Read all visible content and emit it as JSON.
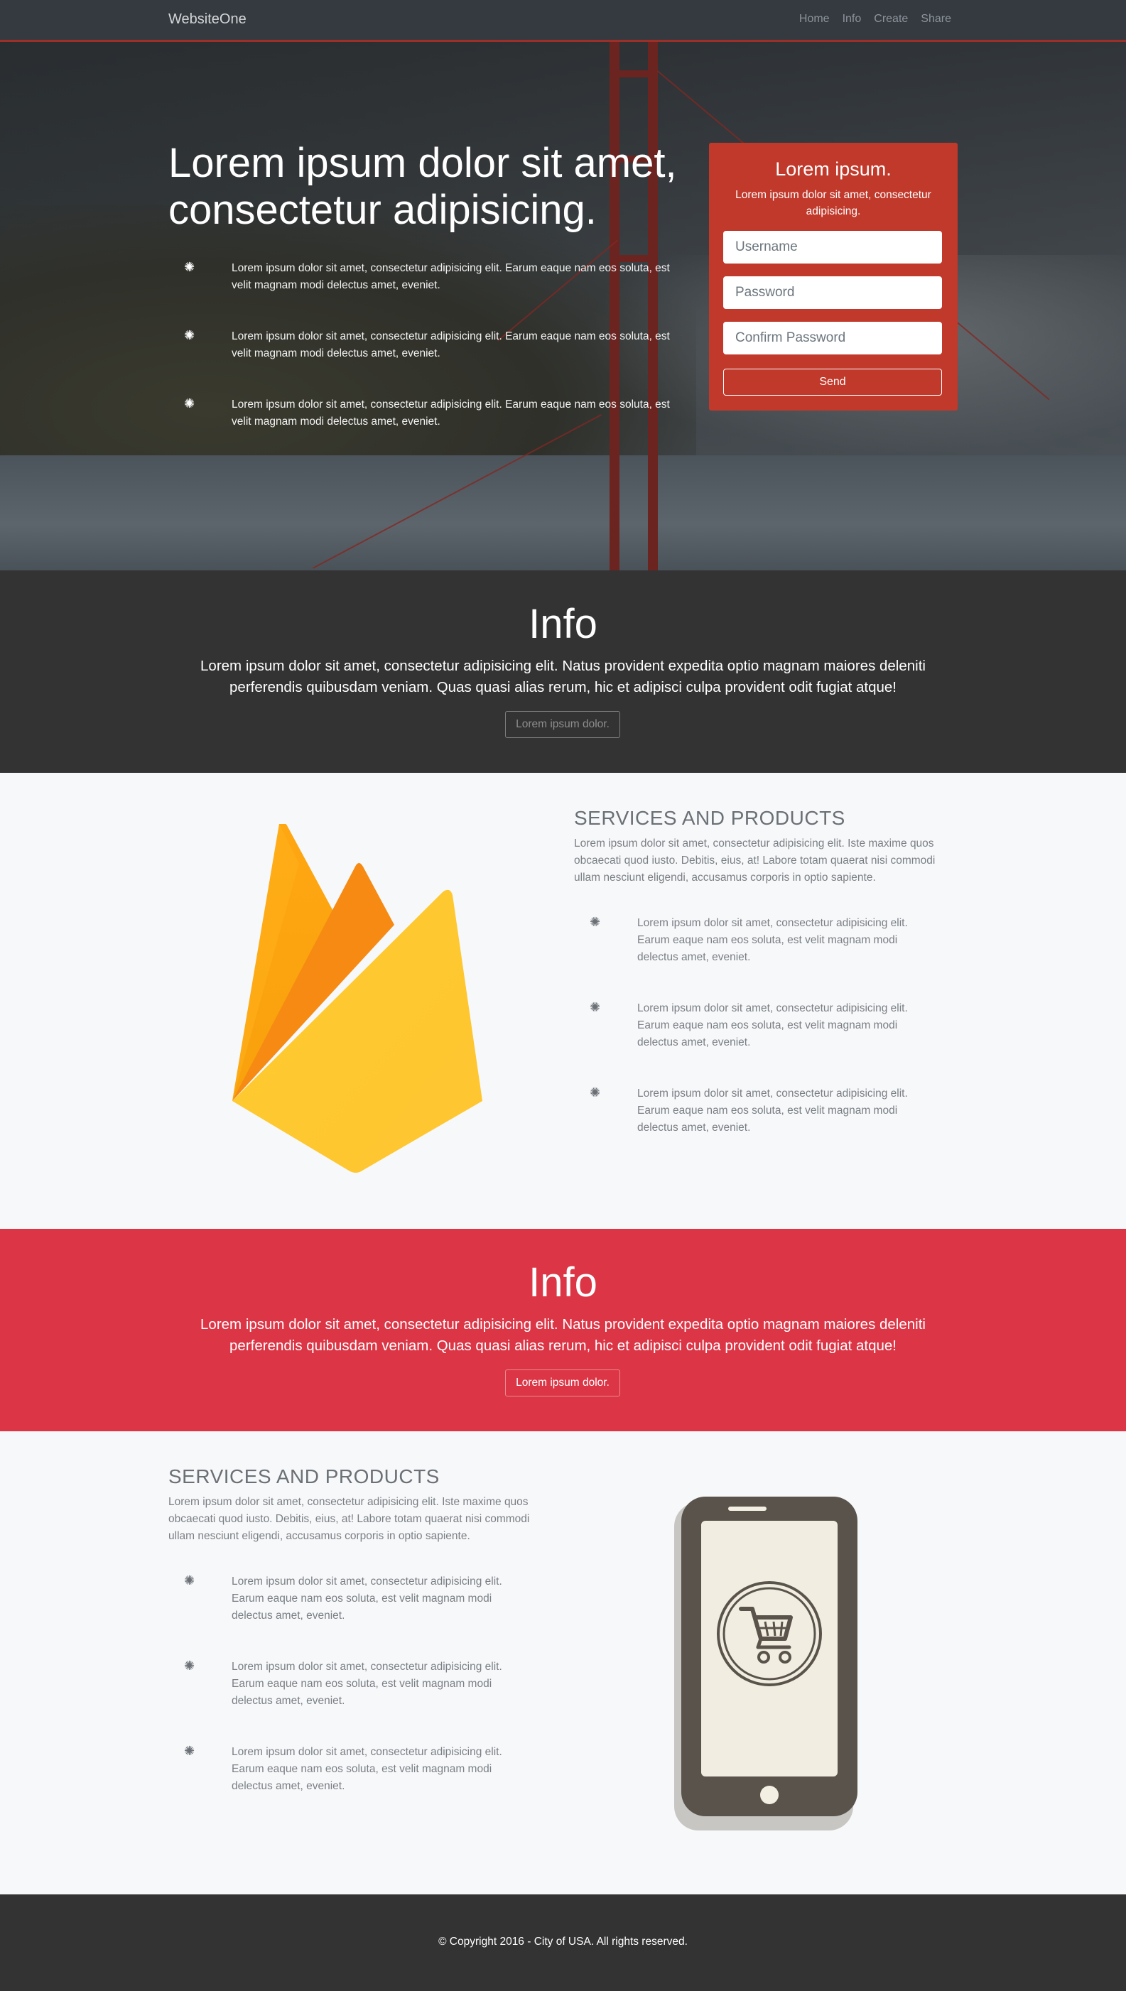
{
  "nav": {
    "brand": "WebsiteOne",
    "links": [
      "Home",
      "Info",
      "Create",
      "Share"
    ]
  },
  "hero": {
    "title": "Lorem ipsum dolor sit amet, consectetur adipisicing.",
    "features": [
      "Lorem ipsum dolor sit amet, consectetur adipisicing elit. Earum eaque nam eos soluta, est velit magnam modi delectus amet, eveniet.",
      "Lorem ipsum dolor sit amet, consectetur adipisicing elit. Earum eaque nam eos soluta, est velit magnam modi delectus amet, eveniet.",
      "Lorem ipsum dolor sit amet, consectetur adipisicing elit. Earum eaque nam eos soluta, est velit magnam modi delectus amet, eveniet."
    ],
    "feature_icon": "gear-icon"
  },
  "form": {
    "title": "Lorem ipsum.",
    "subtitle": "Lorem ipsum dolor sit amet, consectetur adipisicing.",
    "username_placeholder": "Username",
    "password_placeholder": "Password",
    "confirm_placeholder": "Confirm Password",
    "send_label": "Send"
  },
  "info1": {
    "title": "Info",
    "text": "Lorem ipsum dolor sit amet, consectetur adipisicing elit. Natus provident expedita optio magnam maiores deleniti perferendis quibusdam veniam. Quas quasi alias rerum, hic et adipisci culpa provident odit fugiat atque!",
    "button": "Lorem ipsum dolor."
  },
  "services1": {
    "title": "SERVICES AND PRODUCTS",
    "desc": "Lorem ipsum dolor sit amet, consectetur adipisicing elit. Iste maxime quos obcaecati quod iusto. Debitis, eius, at! Labore totam quaerat nisi commodi ullam nesciunt eligendi, accusamus corporis in optio sapiente.",
    "items": [
      "Lorem ipsum dolor sit amet, consectetur adipisicing elit. Earum eaque nam eos soluta, est velit magnam modi delectus amet, eveniet.",
      "Lorem ipsum dolor sit amet, consectetur adipisicing elit. Earum eaque nam eos soluta, est velit magnam modi delectus amet, eveniet.",
      "Lorem ipsum dolor sit amet, consectetur adipisicing elit. Earum eaque nam eos soluta, est velit magnam modi delectus amet, eveniet."
    ],
    "image": "firebase-logo"
  },
  "info2": {
    "title": "Info",
    "text": "Lorem ipsum dolor sit amet, consectetur adipisicing elit. Natus provident expedita optio magnam maiores deleniti perferendis quibusdam veniam. Quas quasi alias rerum, hic et adipisci culpa provident odit fugiat atque!",
    "button": "Lorem ipsum dolor."
  },
  "services2": {
    "title": "SERVICES AND PRODUCTS",
    "desc": "Lorem ipsum dolor sit amet, consectetur adipisicing elit. Iste maxime quos obcaecati quod iusto. Debitis, eius, at! Labore totam quaerat nisi commodi ullam nesciunt eligendi, accusamus corporis in optio sapiente.",
    "items": [
      "Lorem ipsum dolor sit amet, consectetur adipisicing elit. Earum eaque nam eos soluta, est velit magnam modi delectus amet, eveniet.",
      "Lorem ipsum dolor sit amet, consectetur adipisicing elit. Earum eaque nam eos soluta, est velit magnam modi delectus amet, eveniet.",
      "Lorem ipsum dolor sit amet, consectetur adipisicing elit. Earum eaque nam eos soluta, est velit magnam modi delectus amet, eveniet."
    ],
    "image": "phone-cart-illustration"
  },
  "footer": {
    "copyright": "© Copyright 2016 - City of USA. All rights reserved."
  },
  "colors": {
    "nav_bg": "#343a40",
    "form_red": "#c0392b",
    "info_dark": "#333333",
    "info_red": "#dc3545",
    "footer_bg": "#333333"
  }
}
